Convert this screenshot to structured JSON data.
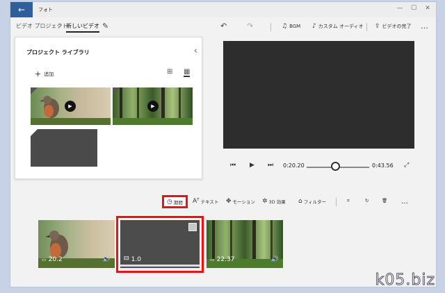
{
  "window": {
    "title": "フォト",
    "back_icon": "←",
    "controls": [
      "—",
      "☐",
      "✕"
    ]
  },
  "breadcrumb": {
    "project": "ビデオ プロジェクト",
    "separator": ">",
    "current": "新しいビデオ",
    "edit_icon": "✎"
  },
  "command_bar": {
    "undo_icon": "↶",
    "redo_icon": "↷",
    "bgm_label": "BGM",
    "bgm_icon": "♫",
    "custom_audio_label": "カスタム オーディオ",
    "custom_audio_icon": "♪",
    "finish_label": "ビデオの完了",
    "finish_icon": "⇪",
    "more_icon": "…"
  },
  "library": {
    "title": "プロジェクト ライブラリ",
    "collapse_icon": "‹",
    "add_label": "追加",
    "add_icon": "+",
    "view_large_icon": "⊞",
    "view_small_icon": "▦",
    "play_icon": "▶"
  },
  "playback": {
    "rewind_icon": "⏮",
    "play_icon": "▶",
    "forward_icon": "⏭",
    "current_time": "0:20.20",
    "total_time": "0:43.56",
    "fullscreen_icon": "⤢",
    "progress": 0.46
  },
  "toolbar": {
    "duration_label": "期間",
    "duration_icon": "◷",
    "text_label": "テキスト",
    "text_icon": "Aᵀ",
    "motion_label": "モーション",
    "motion_icon": "✥",
    "effects_label": "3D 効果",
    "effects_icon": "✲",
    "filter_label": "フィルター",
    "filter_icon": "⌂",
    "resize_icon": "⌗",
    "rotate_icon": "↻",
    "delete_icon": "🗑",
    "more_icon": "…"
  },
  "storyboard": {
    "clips": [
      {
        "duration": "20.2",
        "type_icon": "▭",
        "audio_icon": "🔊"
      },
      {
        "duration": "1.0",
        "type_icon": "🖾"
      },
      {
        "duration": "22.37",
        "type_icon": "▭",
        "audio_icon": "🔊"
      }
    ]
  },
  "watermark": "k05.biz",
  "colors": {
    "accent": "#2f5f9a",
    "highlight": "#e11111"
  }
}
